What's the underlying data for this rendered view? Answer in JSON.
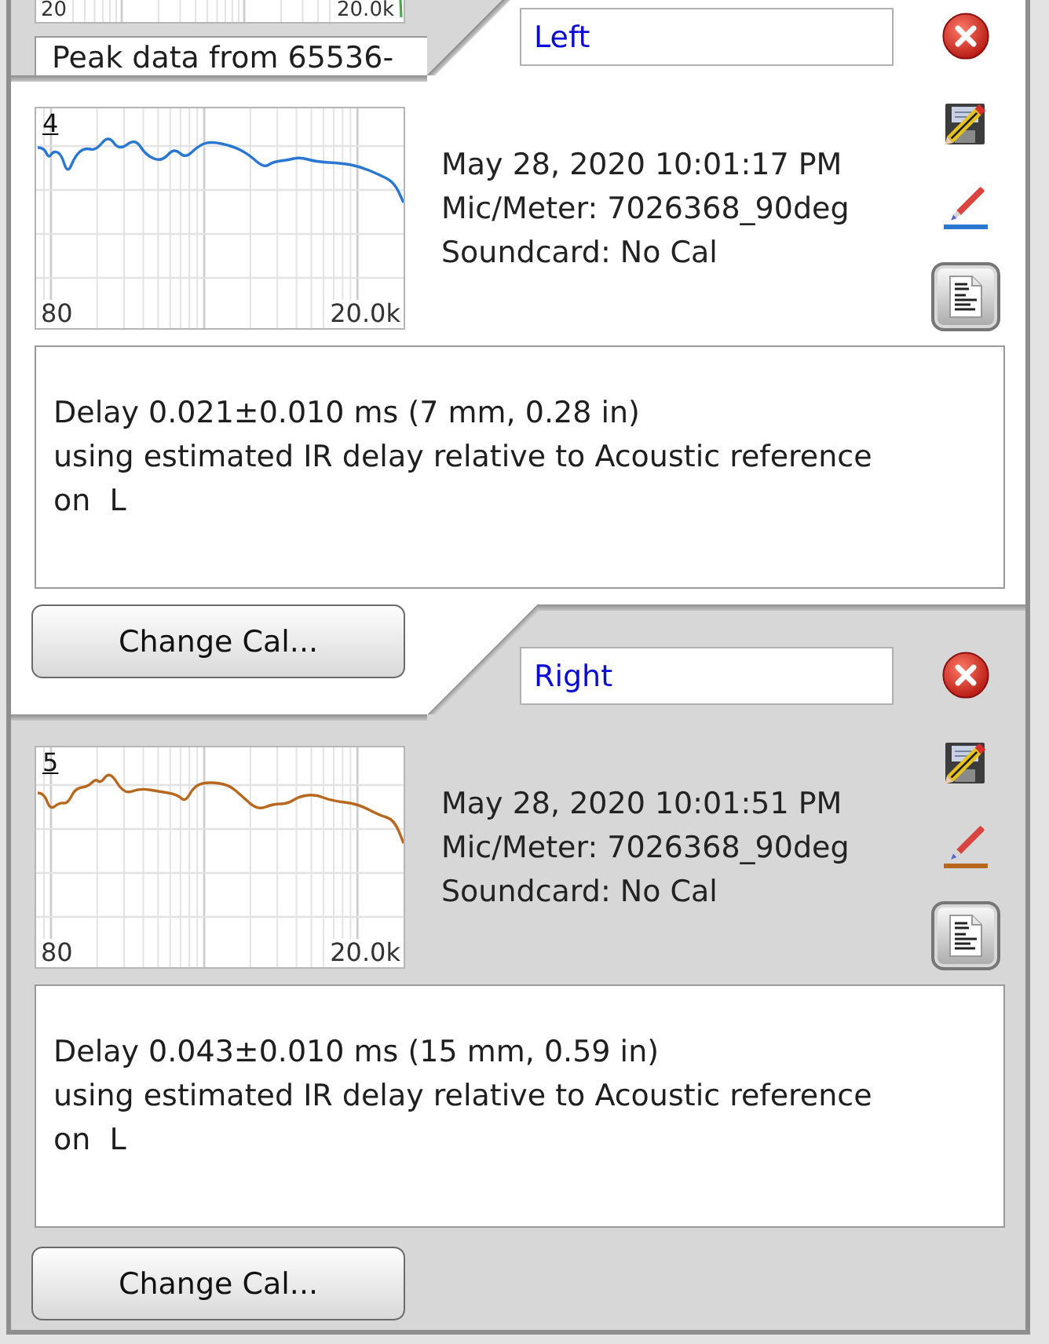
{
  "panels": [
    {
      "kind": "partial",
      "selected": false,
      "color": "#3fae49",
      "graph": {
        "x_start": "20",
        "x_end": "20.0k"
      },
      "notes": "Peak data from 65536-"
    },
    {
      "kind": "full",
      "selected": true,
      "color": "#2a77d2",
      "name": "Left",
      "graph": {
        "number": "4",
        "x_start": "80",
        "x_end": "20.0k"
      },
      "info": [
        "May 28, 2020 10:01:17 PM",
        "Mic/Meter: 7026368_90deg",
        "Soundcard: No Cal"
      ],
      "notes": "Delay 0.021±0.010 ms (7 mm, 0.28 in)\nusing estimated IR delay relative to Acoustic reference\non  L",
      "button": "Change Cal..."
    },
    {
      "kind": "full",
      "selected": false,
      "color": "#b8681e",
      "name": "Right",
      "graph": {
        "number": "5",
        "x_start": "80",
        "x_end": "20.0k"
      },
      "info": [
        "May 28, 2020 10:01:51 PM",
        "Mic/Meter: 7026368_90deg",
        "Soundcard: No Cal"
      ],
      "notes": "Delay 0.043±0.010 ms (15 mm, 0.59 in)\nusing estimated IR delay relative to Acoustic reference\non  L",
      "button": "Change Cal..."
    }
  ]
}
